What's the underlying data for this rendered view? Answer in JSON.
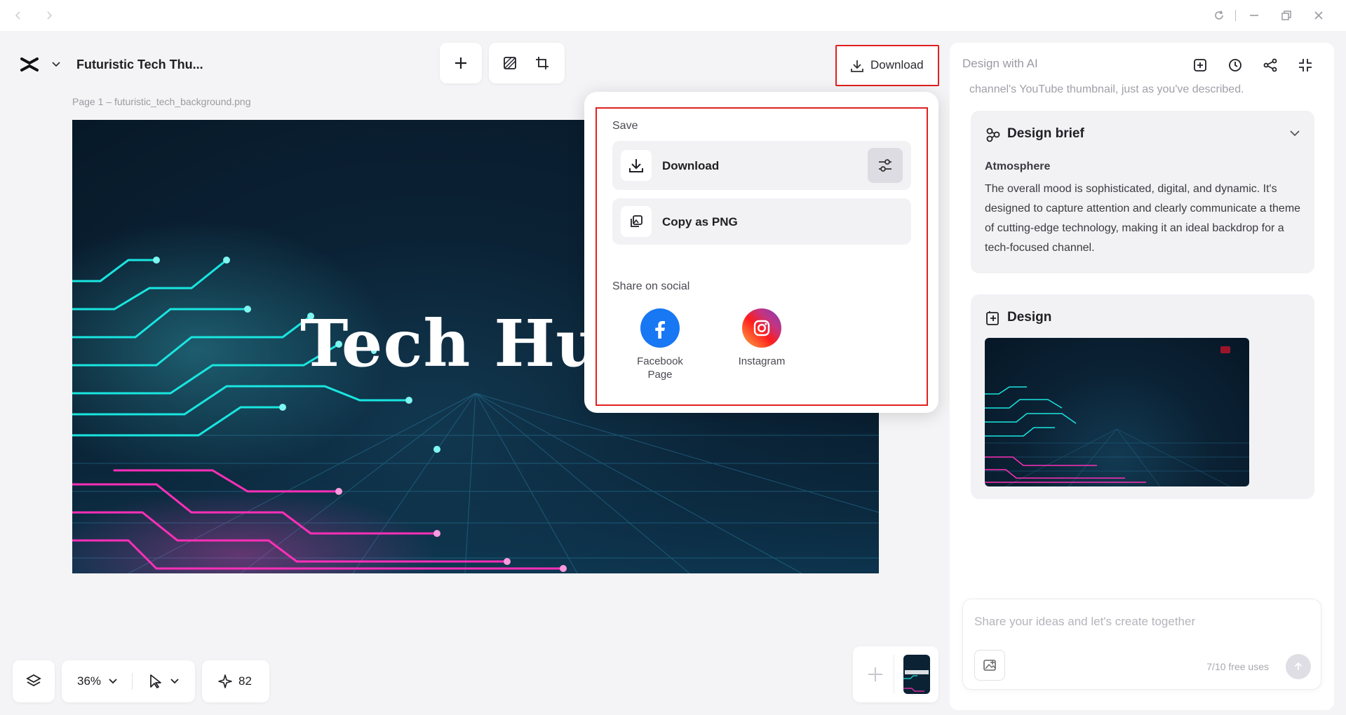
{
  "window": {
    "controls": [
      "back-icon",
      "forward-icon",
      "refresh-icon",
      "minimize-icon",
      "restore-icon",
      "close-icon"
    ]
  },
  "project": {
    "title": "Futuristic Tech Thu..."
  },
  "toolbar": {
    "download_label": "Download"
  },
  "page_label": "Page 1 –  futuristic_tech_background.png",
  "canvas": {
    "headline": "Tech Hu"
  },
  "download_menu": {
    "save_section": "Save",
    "download_option": "Download",
    "copy_option": "Copy as PNG",
    "share_section": "Share on social",
    "social": [
      {
        "name": "Facebook Page",
        "line1": "Facebook",
        "line2": "Page",
        "color": "#1877f2"
      },
      {
        "name": "Instagram",
        "line1": "Instagram",
        "line2": ""
      }
    ]
  },
  "ai_panel": {
    "title": "Design with AI",
    "faded_text": "channel's YouTube thumbnail, just as you've described.",
    "brief": {
      "title": "Design brief",
      "subtitle": "Atmosphere",
      "body": "The overall mood is sophisticated, digital, and dynamic. It's designed to capture attention and clearly communicate a theme of cutting-edge technology, making it an ideal backdrop for a tech-focused channel."
    },
    "design": {
      "title": "Design"
    },
    "chat": {
      "placeholder": "Share your ideas and let's create together",
      "free_uses": "7/10 free uses"
    }
  },
  "bottom": {
    "zoom": "36%",
    "credits": "82"
  },
  "colors": {
    "highlight": "#e02020",
    "neon_cyan": "#19e6e0",
    "neon_pink": "#ff2fb8"
  }
}
